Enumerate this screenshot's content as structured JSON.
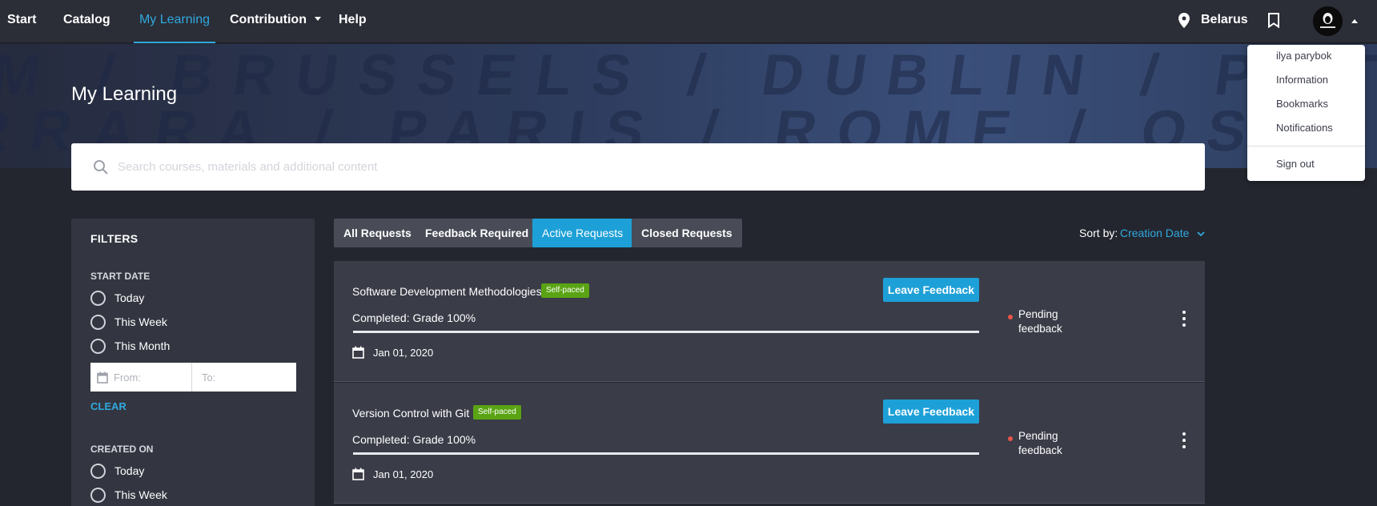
{
  "nav": {
    "start": "Start",
    "catalog": "Catalog",
    "my_learning": "My Learning",
    "contribution": "Contribution",
    "help": "Help",
    "location": "Belarus"
  },
  "banner": {
    "line1": "M / BRUSSELS / DUBLIN / POTSDAM / BRUSSELS",
    "line2": "RRARA / PARIS / ROME / OSLO / FERRARA / PARIS"
  },
  "page_title": "My Learning",
  "search": {
    "placeholder": "Search courses, materials and additional content"
  },
  "filters": {
    "title": "FILTERS",
    "start_date": {
      "label": "START DATE",
      "options": [
        "Today",
        "This Week",
        "This Month"
      ],
      "from_placeholder": "From:",
      "to_placeholder": "To:"
    },
    "clear": "CLEAR",
    "created_on": {
      "label": "CREATED ON",
      "options": [
        "Today",
        "This Week"
      ]
    }
  },
  "tabs": [
    "All Requests",
    "Feedback Required",
    "Active Requests",
    "Closed Requests"
  ],
  "active_tab": "Active Requests",
  "sort": {
    "label": "Sort by:",
    "value": "Creation Date"
  },
  "cards": [
    {
      "title": "Software Development Methodologies",
      "badge": "Self-paced",
      "grade": "Completed: Grade 100%",
      "progress": 1.0,
      "date": "Jan 01, 2020",
      "button": "Leave Feedback",
      "status_line1": "Pending",
      "status_line2": "feedback"
    },
    {
      "title": "Version Control with Git",
      "badge": "Self-paced",
      "grade": "Completed: Grade 100%",
      "progress": 1.0,
      "date": "Jan 01, 2020",
      "button": "Leave Feedback",
      "status_line1": "Pending",
      "status_line2": "feedback"
    }
  ],
  "user_menu": {
    "username": "ilya parybok",
    "information": "Information",
    "bookmarks": "Bookmarks",
    "notifications": "Notifications",
    "sign_out": "Sign out"
  },
  "colors": {
    "accent": "#1da0d7",
    "link": "#2fa9de",
    "badge": "#5aa414",
    "status_dot": "#e9544b",
    "background": "#24262f",
    "card": "#3a3c48"
  }
}
